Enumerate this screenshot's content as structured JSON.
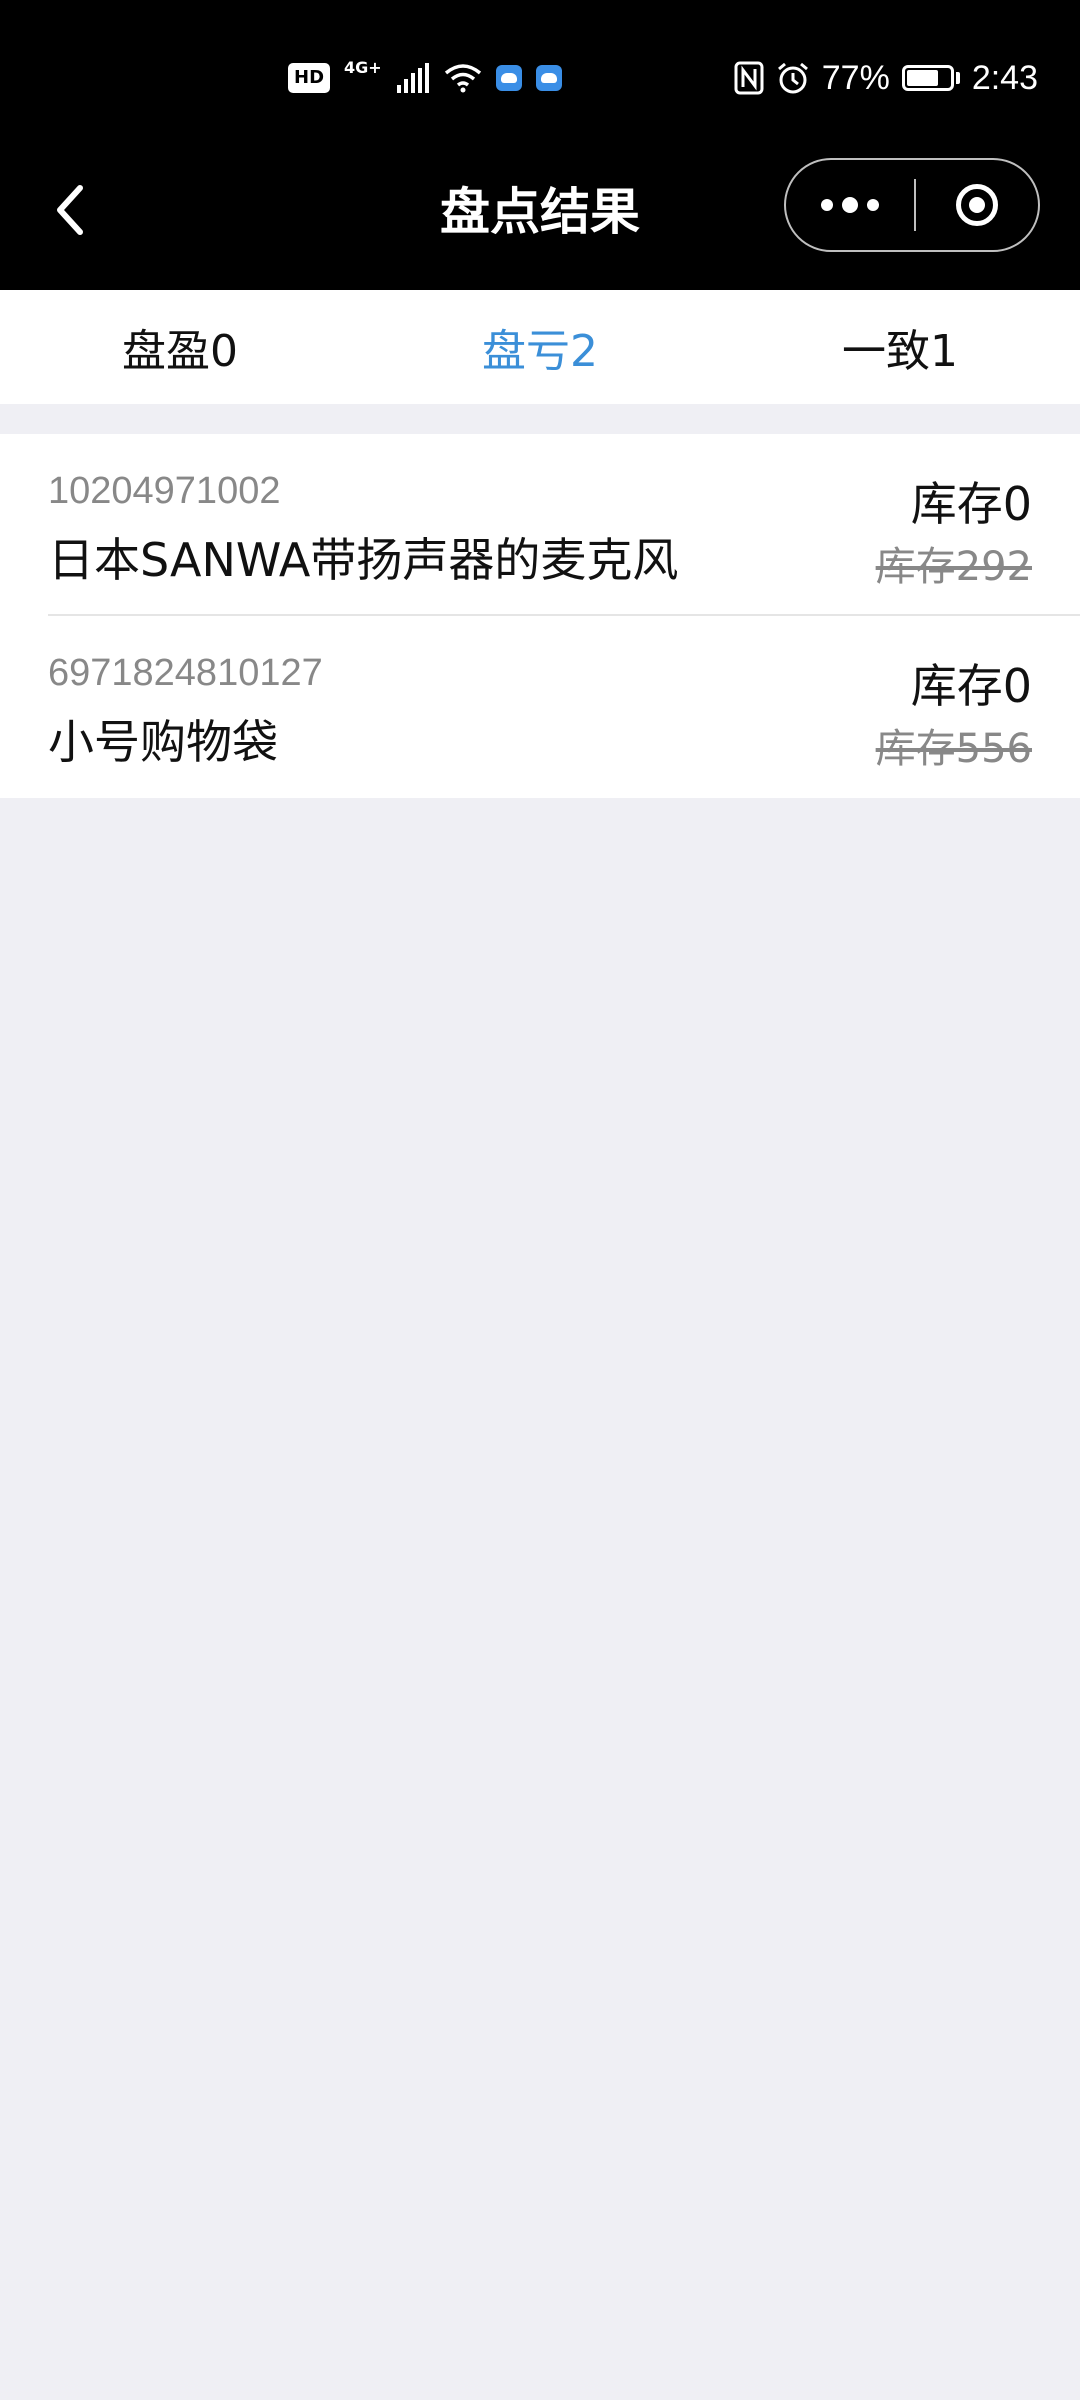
{
  "status_bar": {
    "hd": "HD",
    "network": "4G+",
    "battery_percent": "77%",
    "battery_level": 0.77,
    "time": "2:43"
  },
  "nav": {
    "title": "盘点结果"
  },
  "tabs": [
    {
      "label": "盘盈0",
      "active": false
    },
    {
      "label": "盘亏2",
      "active": true
    },
    {
      "label": "一致1",
      "active": false
    }
  ],
  "items": [
    {
      "code": "10204971002",
      "name": "日本SANWA带扬声器的麦克风",
      "stock": "库存0",
      "old_stock": "库存292"
    },
    {
      "code": "6971824810127",
      "name": "小号购物袋",
      "stock": "库存0",
      "old_stock": "库存556"
    }
  ],
  "colors": {
    "accent": "#3b8fd8",
    "page_bg": "#efeff4",
    "header_bg": "#000000"
  }
}
